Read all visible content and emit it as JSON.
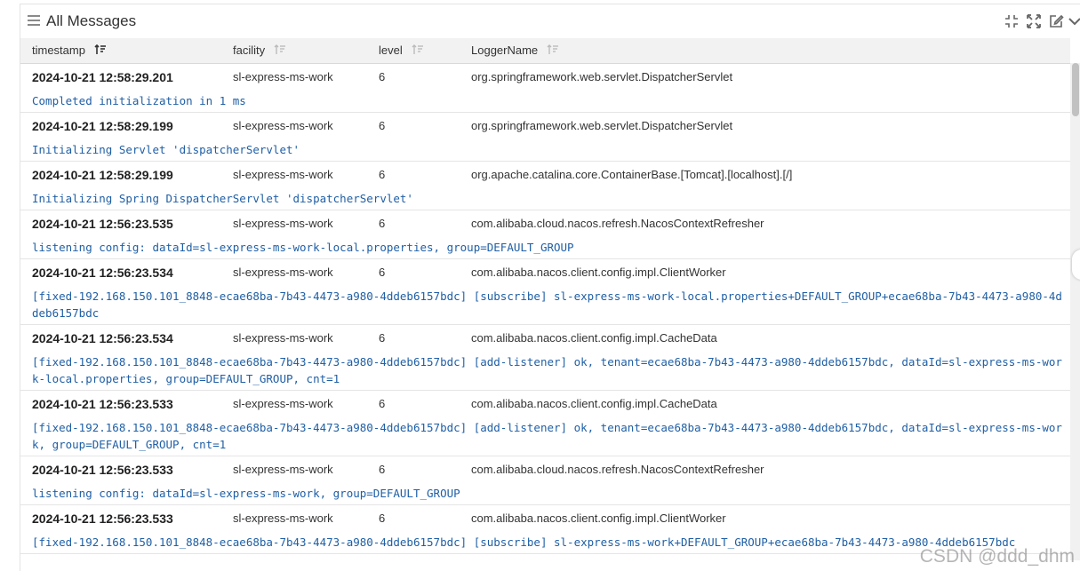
{
  "panel": {
    "title": "All Messages"
  },
  "columns": [
    {
      "label": "timestamp"
    },
    {
      "label": "facility"
    },
    {
      "label": "level"
    },
    {
      "label": "LoggerName"
    }
  ],
  "rows": [
    {
      "timestamp": "2024-10-21 12:58:29.201",
      "facility": "sl-express-ms-work",
      "level": "6",
      "logger": "org.springframework.web.servlet.DispatcherServlet",
      "message": "Completed initialization in 1 ms"
    },
    {
      "timestamp": "2024-10-21 12:58:29.199",
      "facility": "sl-express-ms-work",
      "level": "6",
      "logger": "org.springframework.web.servlet.DispatcherServlet",
      "message": "Initializing Servlet 'dispatcherServlet'"
    },
    {
      "timestamp": "2024-10-21 12:58:29.199",
      "facility": "sl-express-ms-work",
      "level": "6",
      "logger": "org.apache.catalina.core.ContainerBase.[Tomcat].[localhost].[/]",
      "message": "Initializing Spring DispatcherServlet 'dispatcherServlet'"
    },
    {
      "timestamp": "2024-10-21 12:56:23.535",
      "facility": "sl-express-ms-work",
      "level": "6",
      "logger": "com.alibaba.cloud.nacos.refresh.NacosContextRefresher",
      "message": "listening config: dataId=sl-express-ms-work-local.properties, group=DEFAULT_GROUP"
    },
    {
      "timestamp": "2024-10-21 12:56:23.534",
      "facility": "sl-express-ms-work",
      "level": "6",
      "logger": "com.alibaba.nacos.client.config.impl.ClientWorker",
      "message": "[fixed-192.168.150.101_8848-ecae68ba-7b43-4473-a980-4ddeb6157bdc] [subscribe] sl-express-ms-work-local.properties+DEFAULT_GROUP+ecae68ba-7b43-4473-a980-4ddeb6157bdc"
    },
    {
      "timestamp": "2024-10-21 12:56:23.534",
      "facility": "sl-express-ms-work",
      "level": "6",
      "logger": "com.alibaba.nacos.client.config.impl.CacheData",
      "message": "[fixed-192.168.150.101_8848-ecae68ba-7b43-4473-a980-4ddeb6157bdc] [add-listener] ok, tenant=ecae68ba-7b43-4473-a980-4ddeb6157bdc, dataId=sl-express-ms-work-local.properties, group=DEFAULT_GROUP, cnt=1"
    },
    {
      "timestamp": "2024-10-21 12:56:23.533",
      "facility": "sl-express-ms-work",
      "level": "6",
      "logger": "com.alibaba.nacos.client.config.impl.CacheData",
      "message": "[fixed-192.168.150.101_8848-ecae68ba-7b43-4473-a980-4ddeb6157bdc] [add-listener] ok, tenant=ecae68ba-7b43-4473-a980-4ddeb6157bdc, dataId=sl-express-ms-work, group=DEFAULT_GROUP, cnt=1"
    },
    {
      "timestamp": "2024-10-21 12:56:23.533",
      "facility": "sl-express-ms-work",
      "level": "6",
      "logger": "com.alibaba.cloud.nacos.refresh.NacosContextRefresher",
      "message": "listening config: dataId=sl-express-ms-work, group=DEFAULT_GROUP"
    },
    {
      "timestamp": "2024-10-21 12:56:23.533",
      "facility": "sl-express-ms-work",
      "level": "6",
      "logger": "com.alibaba.nacos.client.config.impl.ClientWorker",
      "message": "[fixed-192.168.150.101_8848-ecae68ba-7b43-4473-a980-4ddeb6157bdc] [subscribe] sl-express-ms-work+DEFAULT_GROUP+ecae68ba-7b43-4473-a980-4ddeb6157bdc"
    }
  ],
  "watermark": "CSDN @ddd_dhm",
  "colors": {
    "message_text": "#1f5fa5",
    "header_bg": "#f2f2f2"
  },
  "icons": {
    "menu": "hamburger-icon",
    "header_actions": [
      "compress-icon",
      "expand-icon",
      "edit-icon",
      "chevron-down-icon"
    ],
    "sort": "sort-icon"
  }
}
